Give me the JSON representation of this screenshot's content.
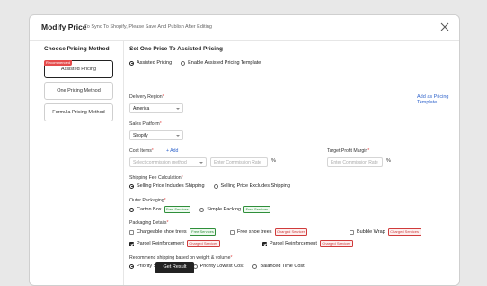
{
  "modal": {
    "title": "Modify Price",
    "subtitle": "To Sync To Shopify, Please Save And Publish After Editing"
  },
  "left": {
    "title": "Choose Pricing Method",
    "methods": [
      {
        "label": "Assisted Pricing",
        "badge": "Recommended",
        "active": true
      },
      {
        "label": "One Pricing Method"
      },
      {
        "label": "Formula Pricing Method"
      }
    ]
  },
  "right": {
    "title": "Set One Price To Assisted Pricing",
    "mode": {
      "options": [
        "Assisted Pricing",
        "Enable Assisted Pricing Template"
      ],
      "selected": 0
    },
    "delivery": {
      "label": "Delivery Region",
      "value": "America",
      "link": "Add as Pricing Template"
    },
    "platform": {
      "label": "Sales Platform",
      "value": "Shopify"
    },
    "cost": {
      "label": "Cost Items",
      "add": "+ Add",
      "method_placeholder": "Select commission method",
      "rate_placeholder": "Enter Commission Rate",
      "unit": "%"
    },
    "margin": {
      "label": "Target Profit Margin",
      "placeholder": "Enter Commission Rate",
      "unit": "%"
    },
    "shipping": {
      "label": "Shipping Fee Calculation",
      "options": [
        "Selling Price Includes Shipping",
        "Selling Price Excludes Shipping"
      ],
      "selected": 0
    },
    "outer": {
      "label": "Outer Packaging",
      "options": [
        {
          "label": "Carton Box",
          "tag": "Free Services"
        },
        {
          "label": "Simple Packing",
          "tag": "Free Services"
        }
      ],
      "selected": 0
    },
    "details": {
      "label": "Packaging Details",
      "items": [
        {
          "label": "Chargeable shoe trees",
          "tag": "Free Services",
          "tag_type": "free",
          "checked": false
        },
        {
          "label": "Free shoe trees",
          "tag": "Charged Services",
          "tag_type": "charged",
          "checked": false
        },
        {
          "label": "Bubble Wrap",
          "tag": "Charged Services",
          "tag_type": "charged",
          "checked": false
        },
        {
          "label": "Parcel Reinforcement",
          "tag": "Charged Services",
          "tag_type": "charged",
          "checked": true
        },
        {
          "label": "Parcel Reinforcement",
          "tag": "Charged Services",
          "tag_type": "charged",
          "checked": true
        }
      ]
    },
    "recommend": {
      "label": "Recommend shipping based on weight & volume",
      "options": [
        "Priority Shortest Time",
        "Priority Lowest Cost",
        "Balanced Time Cost"
      ],
      "selected": 0
    },
    "button": "Get Result"
  },
  "icons": {
    "close": "close-icon"
  }
}
